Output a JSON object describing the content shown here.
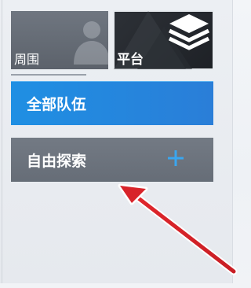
{
  "tabs": {
    "nearby_label": "周围",
    "platform_label": "平台"
  },
  "buttons": {
    "all_teams": "全部队伍",
    "free_explore": "自由探索"
  },
  "icons": {
    "nearby_figure": "person-silhouette-icon",
    "platform": "layers-icon",
    "add": "plus-icon",
    "annotation": "red-arrow-pointer"
  },
  "colors": {
    "accent_blue": "#1f8fe3",
    "plus_blue": "#3aa6ef",
    "annotation_red": "#d8232a"
  }
}
